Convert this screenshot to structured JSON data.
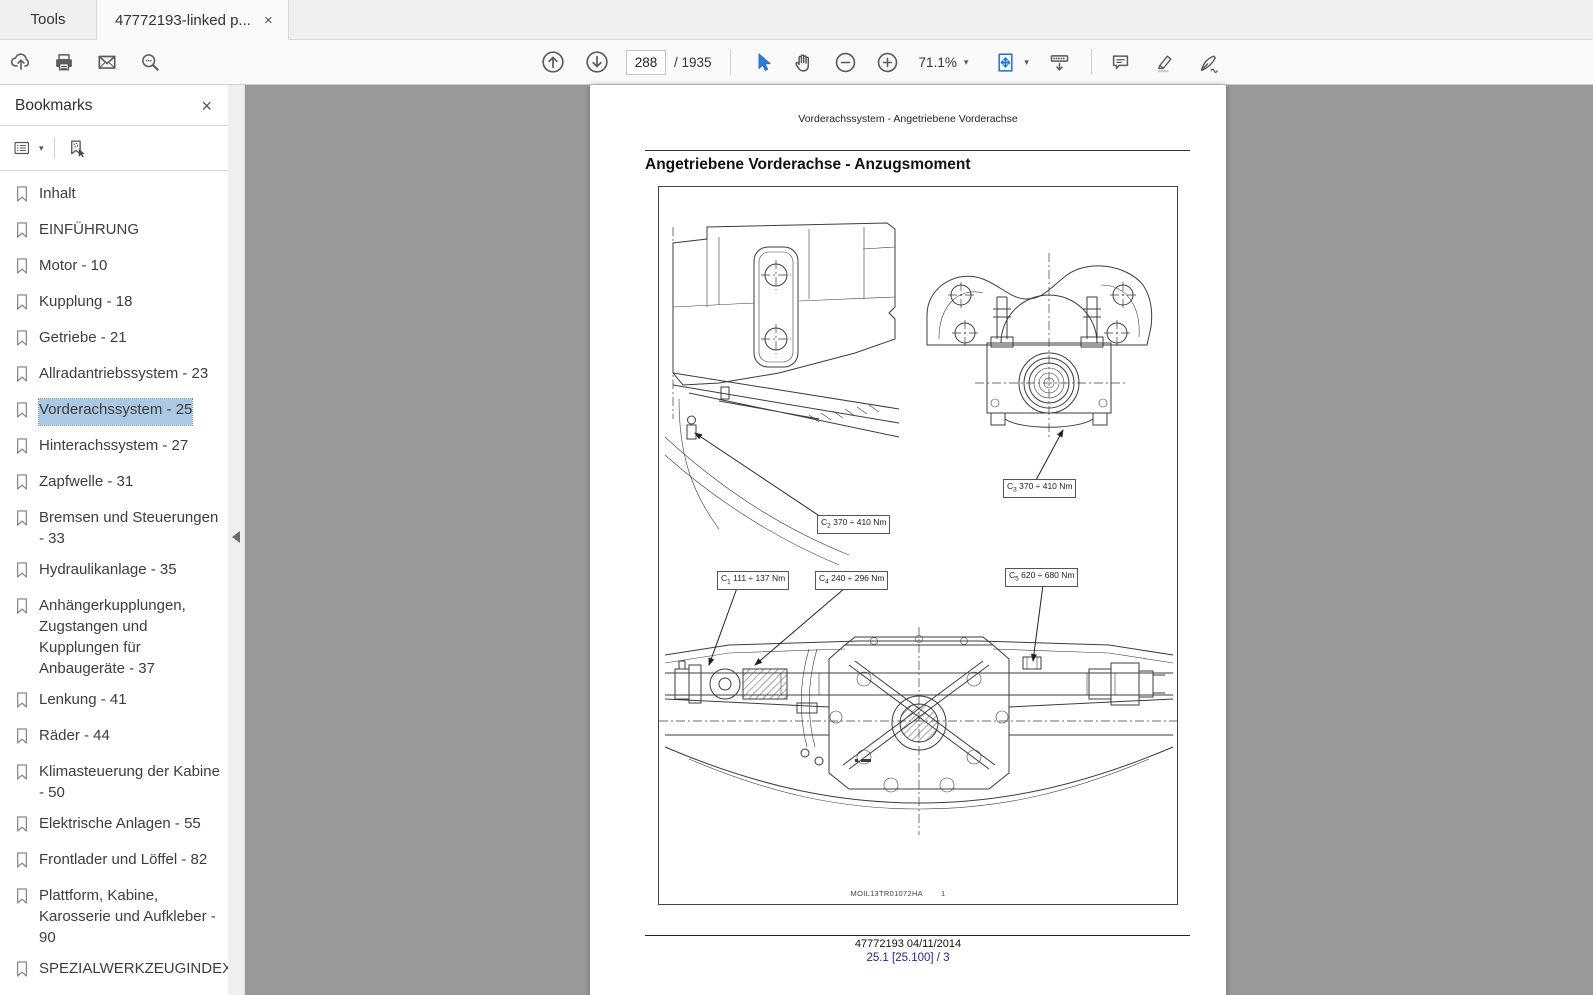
{
  "glyphs": {
    "close": "×",
    "dropdown": "▾"
  },
  "tabbar": {
    "tools_tab": "Tools",
    "document_tab": "47772193-linked p..."
  },
  "toolbar": {
    "page_current": "288",
    "page_total": "/ 1935",
    "zoom_level": "71.1%"
  },
  "sidebar": {
    "title": "Bookmarks",
    "items": [
      {
        "label": "Inhalt"
      },
      {
        "label": "EINFÜHRUNG"
      },
      {
        "label": "Motor - 10"
      },
      {
        "label": "Kupplung - 18"
      },
      {
        "label": "Getriebe - 21"
      },
      {
        "label": "Allradantriebssystem - 23"
      },
      {
        "label": "Vorderachssystem - 25",
        "selected": true
      },
      {
        "label": "Hinterachssystem - 27"
      },
      {
        "label": "Zapfwelle - 31"
      },
      {
        "label": "Bremsen und Steuerungen - 33"
      },
      {
        "label": "Hydraulikanlage - 35"
      },
      {
        "label": "Anhängerkupplungen, Zugstangen und Kupplungen für Anbaugeräte - 37"
      },
      {
        "label": "Lenkung - 41"
      },
      {
        "label": "Räder - 44"
      },
      {
        "label": "Klimasteuerung der Kabine - 50"
      },
      {
        "label": "Elektrische Anlagen - 55"
      },
      {
        "label": "Frontlader und Löffel - 82"
      },
      {
        "label": "Plattform, Kabine, Karosserie und Aufkleber - 90"
      },
      {
        "label": "SPEZIALWERKZEUGINDEX"
      }
    ]
  },
  "document": {
    "running_header": "Vorderachssystem - Angetriebene Vorderachse",
    "title": "Angetriebene Vorderachse - Anzugsmoment",
    "figure": {
      "callouts": {
        "c2": {
          "ref": "C",
          "sub": "2",
          "value": "370 ÷ 410 Nm"
        },
        "c3": {
          "ref": "C",
          "sub": "3",
          "value": "370 ÷ 410 Nm"
        },
        "c1": {
          "ref": "C",
          "sub": "1",
          "value": "111 ÷ 137 Nm"
        },
        "c4": {
          "ref": "C",
          "sub": "4",
          "value": "240 ÷ 296 Nm"
        },
        "c5": {
          "ref": "C",
          "sub": "5",
          "value": "620 ÷ 680 Nm"
        }
      },
      "caption_code": "MOIL13TR01072HA",
      "caption_number": "1"
    },
    "footer": {
      "revision": "47772193 04/11/2014",
      "section_page": "25.1 [25.100] / 3"
    }
  },
  "colors": {
    "accent_blue": "#1473E6",
    "bookmark_selection": "#ABC8E4",
    "canvas_gray": "#999999",
    "footer_link_blue": "#26269B"
  }
}
